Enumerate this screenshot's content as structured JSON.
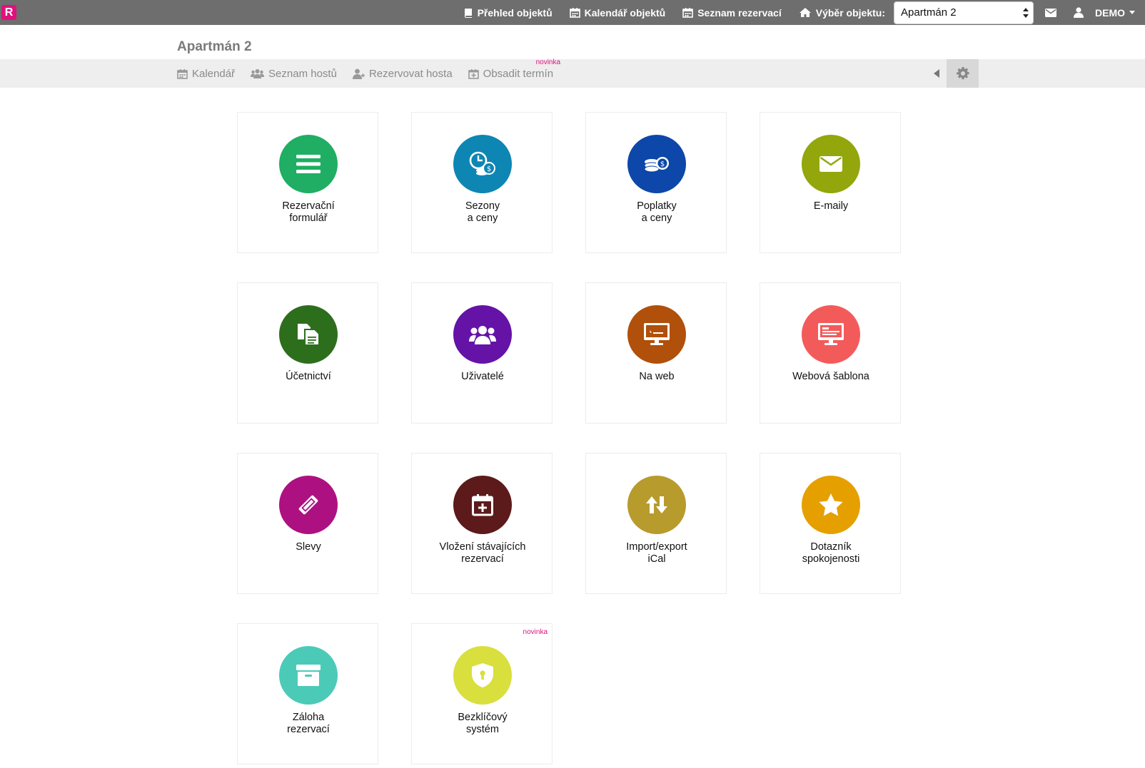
{
  "app": {
    "logo_text": "R"
  },
  "topnav": {
    "overview": "Přehled objektů",
    "calendar": "Kalendář objektů",
    "reservations": "Seznam rezervací",
    "object_select_label": "Výběr objektu:",
    "object_select_value": "Apartmán 2",
    "user": "DEMO"
  },
  "page": {
    "title": "Apartmán 2"
  },
  "subnav": {
    "calendar": "Kalendář",
    "guests": "Seznam hostů",
    "book_guest": "Rezervovat hosta",
    "fill_term": "Obsadit termín",
    "new_badge": "novinka"
  },
  "tiles": [
    {
      "label": "Rezervační\nformulář",
      "color": "#1fae63",
      "icon": "list-icon"
    },
    {
      "label": "Sezony\na ceny",
      "color": "#0e86b3",
      "icon": "clock-coins-icon"
    },
    {
      "label": "Poplatky\na ceny",
      "color": "#0c47a9",
      "icon": "money-icon"
    },
    {
      "label": "E-maily",
      "color": "#93a60b",
      "icon": "envelope-icon"
    },
    {
      "label": "Účetnictví",
      "color": "#2d6e1d",
      "icon": "documents-icon"
    },
    {
      "label": "Uživatelé",
      "color": "#6413a6",
      "icon": "users-icon"
    },
    {
      "label": "Na web",
      "color": "#b0500a",
      "icon": "monitor-icon"
    },
    {
      "label": "Webová šablona",
      "color": "#f35b5b",
      "icon": "template-icon"
    },
    {
      "label": "Slevy",
      "color": "#ad1181",
      "icon": "ticket-icon"
    },
    {
      "label": "Vložení stávajících\nrezervací",
      "color": "#5c1a1a",
      "icon": "calendar-plus-icon"
    },
    {
      "label": "Import/export\niCal",
      "color": "#b79b2c",
      "icon": "import-export-icon"
    },
    {
      "label": "Dotazník\nspokojenosti",
      "color": "#e5a000",
      "icon": "star-icon"
    },
    {
      "label": "Záloha\nrezervací",
      "color": "#4ccab8",
      "icon": "archive-icon"
    },
    {
      "label": "Bezklíčový\nsystém",
      "color": "#d9df3c",
      "icon": "shield-lock-icon",
      "badge": "novinka"
    }
  ]
}
